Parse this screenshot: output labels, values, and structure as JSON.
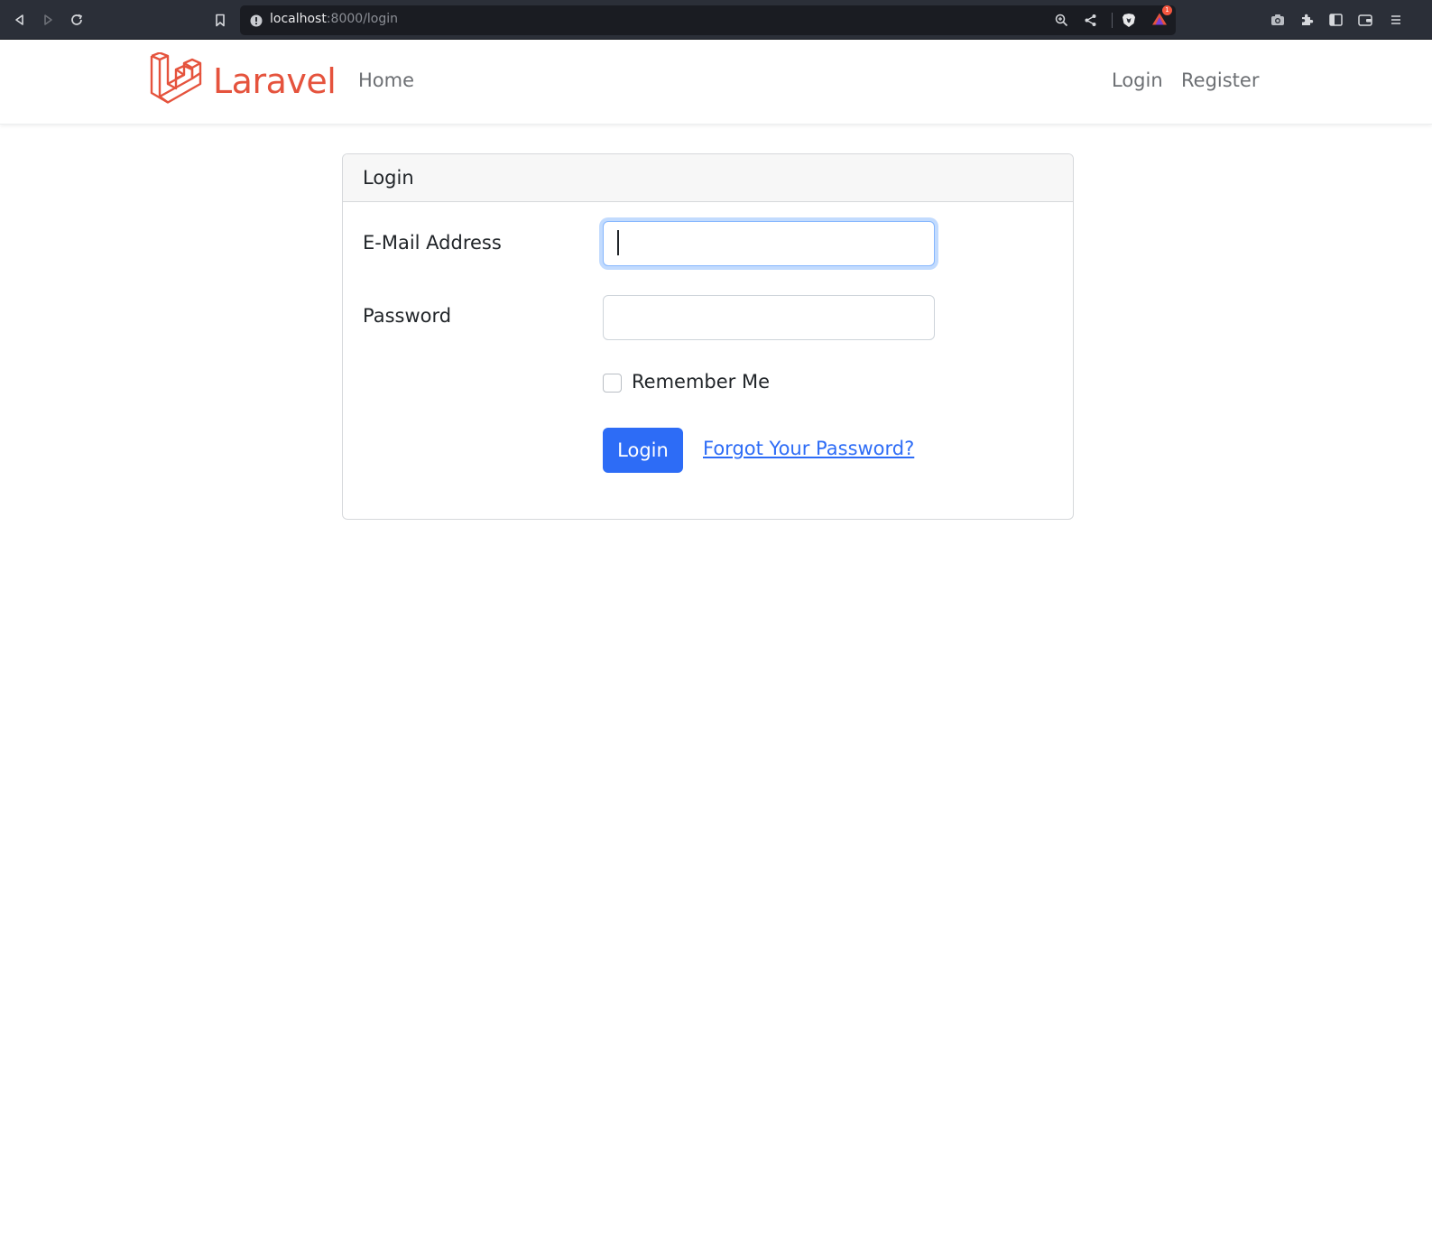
{
  "browser": {
    "url_host": "localhost",
    "url_path": ":8000/login",
    "notification_count": "1",
    "icons": [
      "back-icon",
      "forward-icon",
      "reload-icon",
      "bookmark-icon",
      "site-info-icon",
      "zoom-icon",
      "share-icon",
      "brave-shield-icon",
      "brave-rewards-icon",
      "screenshot-icon",
      "extensions-icon",
      "sidebar-icon",
      "wallet-icon",
      "menu-icon"
    ]
  },
  "navbar": {
    "brand": "Laravel",
    "home_label": "Home",
    "login_label": "Login",
    "register_label": "Register"
  },
  "login_card": {
    "title": "Login",
    "email_label": "E-Mail Address",
    "email_value": "",
    "password_label": "Password",
    "password_value": "",
    "remember_label": "Remember Me",
    "remember_checked": false,
    "submit_label": "Login",
    "forgot_label": "Forgot Your Password?"
  },
  "colors": {
    "brand": "#e5533d",
    "primary": "#2d6cf6"
  }
}
